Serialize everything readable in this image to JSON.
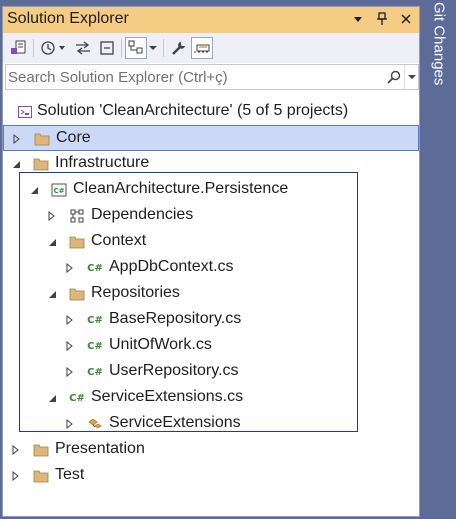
{
  "window": {
    "title": "Solution Explorer",
    "side_tab": "Git Changes"
  },
  "search": {
    "placeholder": "Search Solution Explorer (Ctrl+ç)"
  },
  "tree": {
    "solution": "Solution 'CleanArchitecture' (5 of 5 projects)",
    "core": "Core",
    "infrastructure": "Infrastructure",
    "project": "CleanArchitecture.Persistence",
    "dependencies": "Dependencies",
    "context": "Context",
    "appdbcontext": "AppDbContext.cs",
    "repositories": "Repositories",
    "baserepo": "BaseRepository.cs",
    "unitofwork": "UnitOfWork.cs",
    "userrepo": "UserRepository.cs",
    "serviceext_file": "ServiceExtensions.cs",
    "serviceext_class": "ServiceExtensions",
    "presentation": "Presentation",
    "test": "Test"
  },
  "icons": {
    "csharp_glyph": "C#"
  },
  "colors": {
    "title_bar": "#f5cc84",
    "frame": "#5d6b99",
    "selection": "#ccd9f6",
    "folder": "#dcb67a",
    "csharp": "#388a34"
  }
}
